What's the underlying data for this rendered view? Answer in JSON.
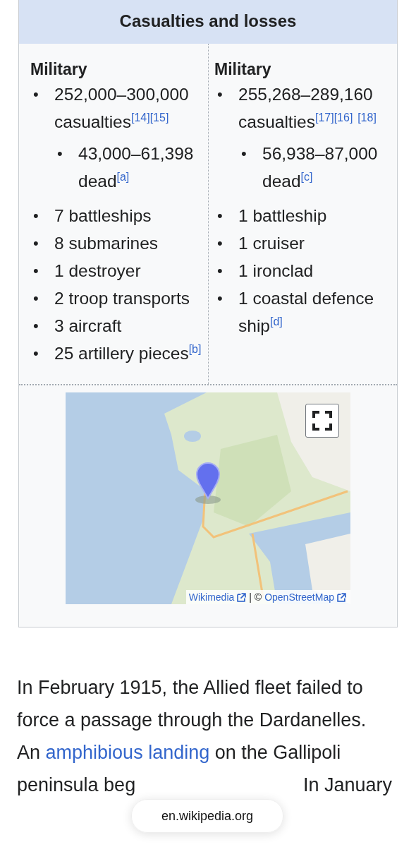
{
  "infobox": {
    "header": "Casualties and losses",
    "columns": [
      {
        "heading": "Military",
        "items": [
          {
            "marker": "•",
            "text": "252,000–300,000 casualties$^{[14][15]}$",
            "children": [
              {
                "marker": "•",
                "text": "43,000–61,398 dead$^{[a]}$"
              }
            ]
          },
          {
            "marker": "•",
            "text": "7 battleships"
          },
          {
            "marker": "•",
            "text": "8 submarines"
          },
          {
            "marker": "•",
            "text": "1 destroyer"
          },
          {
            "marker": "•",
            "text": "2 troop transports"
          },
          {
            "marker": "•",
            "text": "3 aircraft"
          },
          {
            "marker": "•",
            "text": "25 artillery pieces$^{[b]}$"
          }
        ]
      },
      {
        "heading": "Military",
        "items": [
          {
            "marker": "•",
            "text": "255,268–289,160 casualties$^{[17][16]}$ $^{[18]}$",
            "children": [
              {
                "marker": "•",
                "text": "56,938–87,000 dead$^{[c]}$"
              }
            ]
          },
          {
            "marker": "•",
            "text": "1 battleship"
          },
          {
            "marker": "•",
            "text": "1 cruiser"
          },
          {
            "marker": "•",
            "text": "1 ironclad"
          },
          {
            "marker": "•",
            "text": "1 coastal defence ship$^{[d]}$"
          }
        ]
      }
    ],
    "map": {
      "kind": "picture",
      "attribution": [
        {
          "text": "Wikimedia"
        },
        {
          "separator": "| ©"
        },
        {
          "text": "OpenStreetMap"
        }
      ]
    }
  },
  "paragraph": {
    "before_link": "In February 1915, the Allied fleet failed to force a passage through the Dardanelles. An",
    "link": "amphibious landing",
    "after_link": "on the Gallipoli",
    "line_start": "peninsula beg",
    "line_end": "In January"
  },
  "address_pill": "en.wikipedia.org"
}
